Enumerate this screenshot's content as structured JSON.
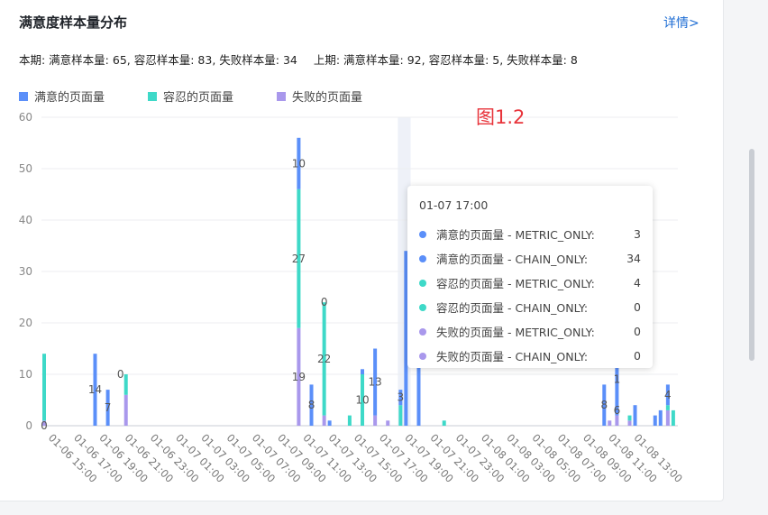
{
  "title": "满意度样本量分布",
  "details_link": "详情>",
  "summary": {
    "current": "本期: 满意样本量: 65, 容忍样本量: 83, 失败样本量: 34",
    "previous": "上期: 满意样本量: 92, 容忍样本量: 5, 失败样本量: 8"
  },
  "figure_label": "图1.2",
  "colors": {
    "satisfied": "#5b8ff9",
    "tolerating": "#3ed9c8",
    "failed": "#a998ec"
  },
  "legend": [
    {
      "label": "满意的页面量",
      "color": "#5b8ff9"
    },
    {
      "label": "容忍的页面量",
      "color": "#3ed9c8"
    },
    {
      "label": "失败的页面量",
      "color": "#a998ec"
    }
  ],
  "tooltip": {
    "time": "01-07 17:00",
    "rows": [
      {
        "label": "满意的页面量 - METRIC_ONLY:",
        "value": "3",
        "color": "#5b8ff9"
      },
      {
        "label": "满意的页面量 - CHAIN_ONLY:",
        "value": "34",
        "color": "#5b8ff9"
      },
      {
        "label": "容忍的页面量 - METRIC_ONLY:",
        "value": "4",
        "color": "#3ed9c8"
      },
      {
        "label": "容忍的页面量 - CHAIN_ONLY:",
        "value": "0",
        "color": "#3ed9c8"
      },
      {
        "label": "失败的页面量 - METRIC_ONLY:",
        "value": "0",
        "color": "#a998ec"
      },
      {
        "label": "失败的页面量 - CHAIN_ONLY:",
        "value": "0",
        "color": "#a998ec"
      }
    ]
  },
  "chart_data": {
    "type": "bar",
    "stacked": true,
    "ylim": [
      0,
      60
    ],
    "yticks": [
      0,
      10,
      20,
      30,
      40,
      50,
      60
    ],
    "grid": true,
    "x_labels": [
      "01-06 15:00",
      "01-06 17:00",
      "01-06 19:00",
      "01-06 21:00",
      "01-06 23:00",
      "01-07 01:00",
      "01-07 03:00",
      "01-07 05:00",
      "01-07 07:00",
      "01-07 09:00",
      "01-07 11:00",
      "01-07 13:00",
      "01-07 15:00",
      "01-07 17:00",
      "01-07 19:00",
      "01-07 21:00",
      "01-07 23:00",
      "01-08 01:00",
      "01-08 03:00",
      "01-08 05:00",
      "01-08 07:00",
      "01-08 09:00",
      "01-08 11:00",
      "01-08 13:00"
    ],
    "highlight_slot": 28,
    "bars": [
      {
        "slot": 0,
        "sub": 0,
        "failed": 1,
        "tolerating": 13,
        "satisfied": 0
      },
      {
        "slot": 4,
        "sub": 0,
        "failed": 0,
        "tolerating": 0,
        "satisfied": 14
      },
      {
        "slot": 5,
        "sub": 0,
        "failed": 0,
        "tolerating": 0,
        "satisfied": 7
      },
      {
        "slot": 6,
        "sub": 1,
        "failed": 6,
        "tolerating": 4,
        "satisfied": 0
      },
      {
        "slot": 20,
        "sub": 0,
        "failed": 19,
        "tolerating": 27,
        "satisfied": 10
      },
      {
        "slot": 21,
        "sub": 0,
        "failed": 0,
        "tolerating": 0,
        "satisfied": 8
      },
      {
        "slot": 22,
        "sub": 0,
        "failed": 2,
        "tolerating": 22,
        "satisfied": 0
      },
      {
        "slot": 22,
        "sub": 1,
        "failed": 0,
        "tolerating": 0,
        "satisfied": 1
      },
      {
        "slot": 24,
        "sub": 0,
        "failed": 0,
        "tolerating": 2,
        "satisfied": 0
      },
      {
        "slot": 25,
        "sub": 0,
        "failed": 0,
        "tolerating": 10,
        "satisfied": 1
      },
      {
        "slot": 26,
        "sub": 0,
        "failed": 2,
        "tolerating": 0,
        "satisfied": 13
      },
      {
        "slot": 27,
        "sub": 0,
        "failed": 1,
        "tolerating": 0,
        "satisfied": 0
      },
      {
        "slot": 28,
        "sub": 0,
        "failed": 0,
        "tolerating": 4,
        "satisfied": 3
      },
      {
        "slot": 28,
        "sub": 1,
        "failed": 0,
        "tolerating": 0,
        "satisfied": 34
      },
      {
        "slot": 29,
        "sub": 1,
        "failed": 0,
        "tolerating": 0,
        "satisfied": 34
      },
      {
        "slot": 31,
        "sub": 1,
        "failed": 0,
        "tolerating": 1,
        "satisfied": 0
      },
      {
        "slot": 44,
        "sub": 0,
        "failed": 0,
        "tolerating": 0,
        "satisfied": 8
      },
      {
        "slot": 44,
        "sub": 1,
        "failed": 1,
        "tolerating": 0,
        "satisfied": 0
      },
      {
        "slot": 45,
        "sub": 0,
        "failed": 2,
        "tolerating": 0,
        "satisfied": 14
      },
      {
        "slot": 46,
        "sub": 0,
        "failed": 1,
        "tolerating": 1,
        "satisfied": 0
      },
      {
        "slot": 46,
        "sub": 1,
        "failed": 0,
        "tolerating": 0,
        "satisfied": 4
      },
      {
        "slot": 48,
        "sub": 0,
        "failed": 0,
        "tolerating": 0,
        "satisfied": 2
      },
      {
        "slot": 48,
        "sub": 1,
        "failed": 0,
        "tolerating": 0,
        "satisfied": 3
      },
      {
        "slot": 49,
        "sub": 0,
        "failed": 3,
        "tolerating": 1,
        "satisfied": 4
      },
      {
        "slot": 49,
        "sub": 1,
        "failed": 0,
        "tolerating": 3,
        "satisfied": 0
      }
    ],
    "data_labels": [
      {
        "slot": 0,
        "value": 0,
        "text": "0"
      },
      {
        "slot": 4,
        "value": 7,
        "text": "14"
      },
      {
        "slot": 5,
        "value": 3.5,
        "text": "7"
      },
      {
        "slot": 6,
        "value": 10,
        "text": "0"
      },
      {
        "slot": 20,
        "value": 51,
        "text": "10"
      },
      {
        "slot": 20,
        "value": 32.5,
        "text": "27"
      },
      {
        "slot": 20,
        "value": 9.5,
        "text": "19"
      },
      {
        "slot": 21,
        "value": 4,
        "text": "8"
      },
      {
        "slot": 22,
        "value": 24,
        "text": "0"
      },
      {
        "slot": 22,
        "value": 13,
        "text": "22"
      },
      {
        "slot": 25,
        "value": 5,
        "text": "10"
      },
      {
        "slot": 26,
        "value": 8.5,
        "text": "13"
      },
      {
        "slot": 28,
        "value": 5.5,
        "text": "3"
      },
      {
        "slot": 29,
        "value": 17,
        "text": "3"
      },
      {
        "slot": 44,
        "value": 4,
        "text": "8"
      },
      {
        "slot": 45,
        "value": 9,
        "text": "1"
      },
      {
        "slot": 45,
        "value": 3,
        "text": "6"
      },
      {
        "slot": 49,
        "value": 6,
        "text": "4"
      }
    ]
  }
}
